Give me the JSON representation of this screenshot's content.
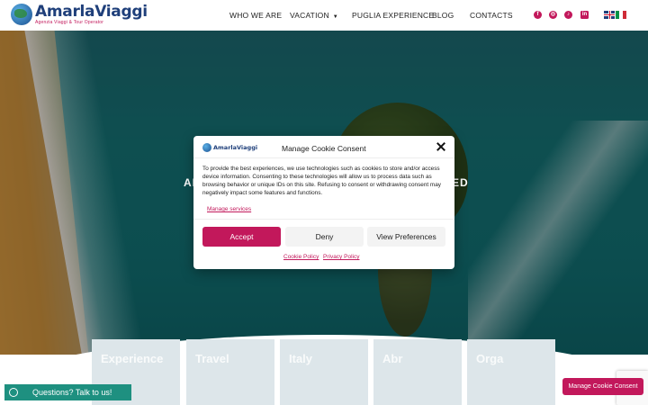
{
  "brand": {
    "name": "AmarlaViaggi",
    "tagline": "Agenzia Viaggi & Tour Operator"
  },
  "nav": {
    "items": [
      {
        "label": "WHO WE ARE"
      },
      {
        "label": "VACATION",
        "has_dropdown": true
      },
      {
        "label": "PUGLIA EXPERIENCE"
      },
      {
        "label": "BLOG"
      },
      {
        "label": "CONTACTS"
      }
    ]
  },
  "social": [
    {
      "icon": "facebook-icon",
      "glyph": "f"
    },
    {
      "icon": "instagram-icon",
      "glyph": "◎"
    },
    {
      "icon": "tiktok-icon",
      "glyph": "♪"
    },
    {
      "icon": "linkedin-icon",
      "glyph": "in"
    }
  ],
  "languages": [
    {
      "flag": "uk-flag"
    },
    {
      "flag": "italy-flag"
    }
  ],
  "hero": {
    "title_left": "AN",
    "title_right": "ED"
  },
  "tiles": [
    {
      "label": "Experience"
    },
    {
      "label": "Travel"
    },
    {
      "label": "Italy"
    },
    {
      "label": "Abr"
    },
    {
      "label": "Orga"
    }
  ],
  "cookie": {
    "logo_text": "AmarlaViaggi",
    "title": "Manage Cookie Consent",
    "body": "To provide the best experiences, we use technologies such as cookies to store and/or access device information. Consenting to these technologies will allow us to process data such as browsing behavior or unique IDs on this site. Refusing to consent or withdrawing consent may negatively impact some features and functions.",
    "manage_services": "Manage services",
    "accept": "Accept",
    "deny": "Deny",
    "preferences": "View Preferences",
    "cookie_policy": "Cookie Policy",
    "privacy_policy": "Privacy Policy"
  },
  "whatsapp": {
    "label": "Questions? Talk to us!"
  },
  "manage_consent": {
    "label": "Manage Cookie Consent"
  },
  "colors": {
    "accent": "#c2185b",
    "brand_blue": "#1f3f7a",
    "whatsapp": "#1e9080"
  }
}
